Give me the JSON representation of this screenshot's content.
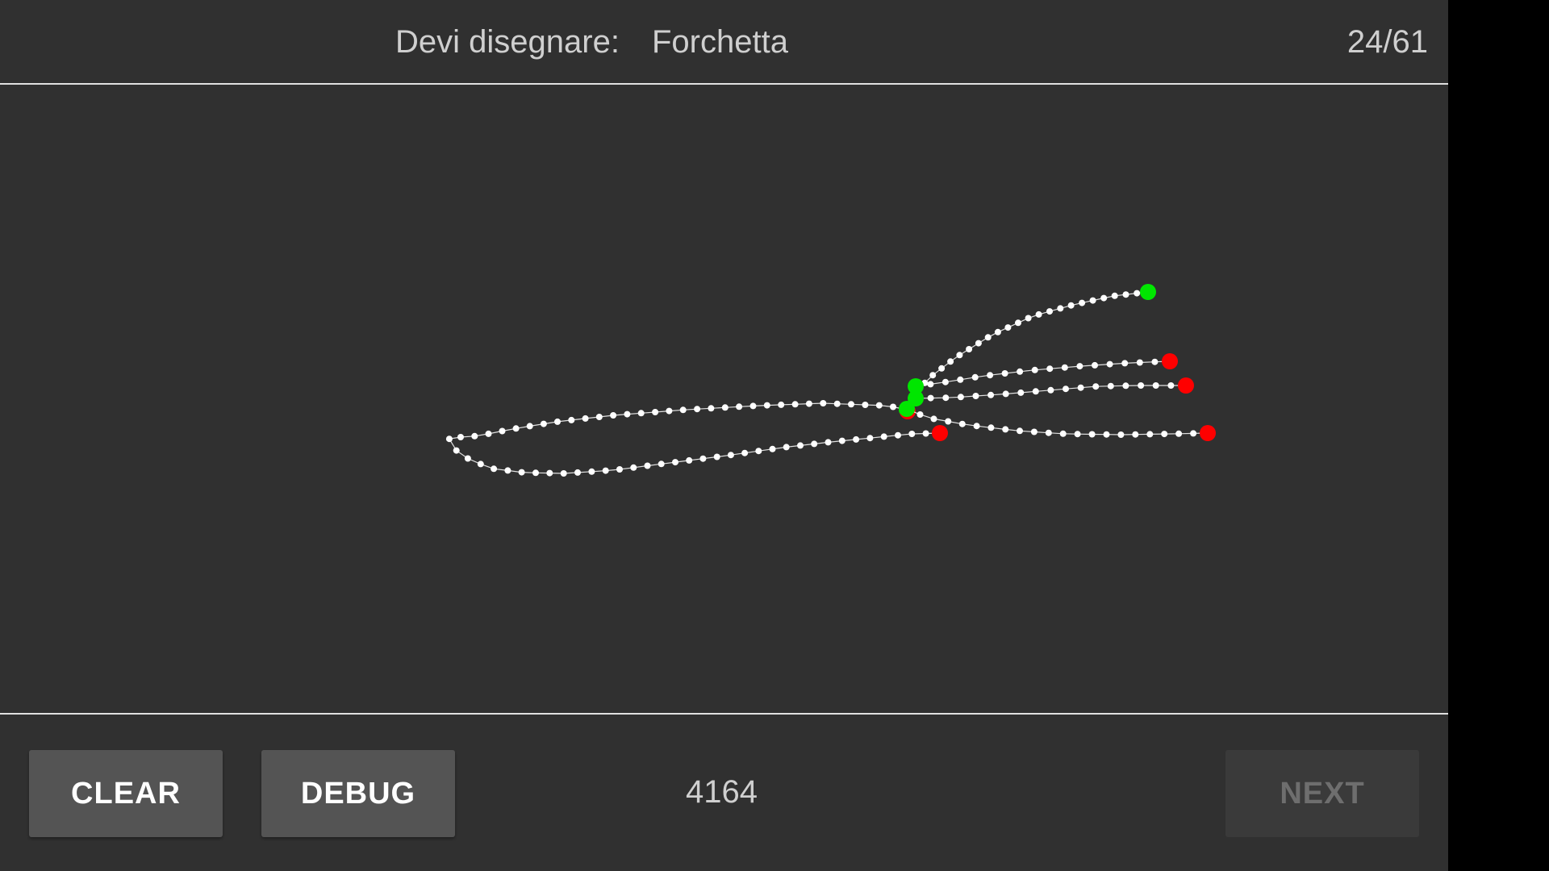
{
  "header": {
    "prompt_label": "Devi disegnare:",
    "prompt_word": "Forchetta",
    "progress": "24/61"
  },
  "footer": {
    "clear_label": "CLEAR",
    "debug_label": "DEBUG",
    "score": "4164",
    "next_label": "NEXT"
  },
  "colors": {
    "background": "#303030",
    "stroke": "#ffffff",
    "stroke_start": "#00e600",
    "stroke_end": "#ff0000",
    "button": "#545454",
    "button_disabled": "#3a3a3a"
  }
}
